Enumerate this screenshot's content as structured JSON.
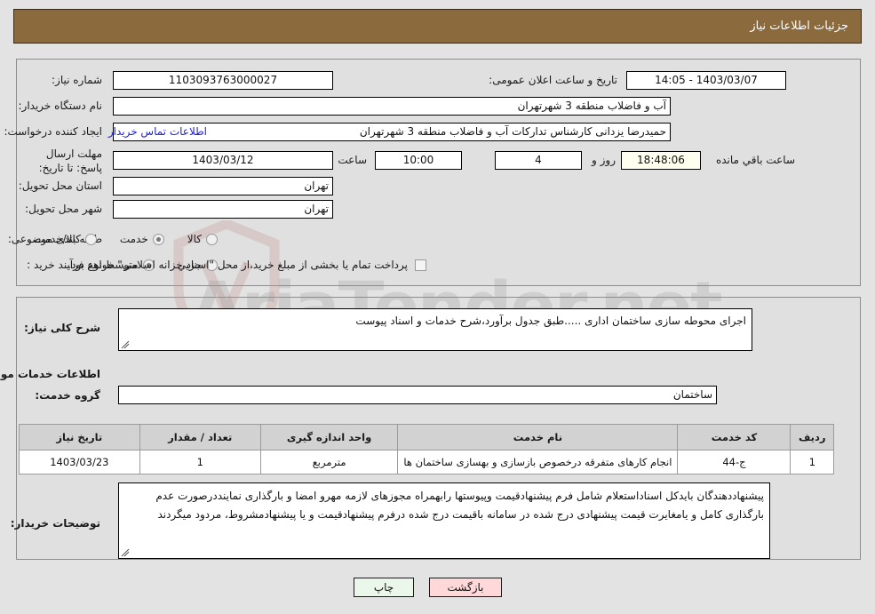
{
  "header": {
    "title": "جزئیات اطلاعات نیاز"
  },
  "top_panel": {
    "need_number_label": "شماره نیاز:",
    "need_number_value": "1103093763000027",
    "announce_datetime_label": "تاریخ و ساعت اعلان عمومی:",
    "announce_datetime_value": "1403/03/07 - 14:05",
    "buyer_org_label": "نام دستگاه خریدار:",
    "buyer_org_value": "آب و فاضلاب منطقه 3 شهرتهران",
    "requester_label": "ایجاد کننده درخواست:",
    "requester_value": "حمیدرضا یزدانی کارشناس تدارکات آب و فاضلاب منطقه 3 شهرتهران",
    "buyer_contact_link": "اطلاعات تماس خریدار",
    "deadline_label": "مهلت ارسال پاسخ: تا تاریخ:",
    "deadline_date_value": "1403/03/12",
    "deadline_time_label": "ساعت",
    "deadline_time_value": "10:00",
    "days_remaining_value": "4",
    "days_label": "روز و",
    "time_remaining_value": "18:48:06",
    "time_remaining_label": "ساعت باقي مانده",
    "province_label": "استان محل تحویل:",
    "province_value": "تهران",
    "city_label": "شهر محل تحویل:",
    "city_value": "تهران",
    "category_label": "طبقه بندی موضوعی:",
    "category_options": [
      {
        "label": "کالا",
        "selected": false
      },
      {
        "label": "خدمت",
        "selected": true
      },
      {
        "label": "کالا/خدمت",
        "selected": false
      }
    ],
    "process_label": "نوع فرآیند خرید :",
    "process_options": [
      {
        "label": "جزیي",
        "selected": false
      },
      {
        "label": "متوسط",
        "selected": true
      }
    ],
    "treasury_checkbox_checked": false,
    "treasury_text": "پرداخت تمام یا بخشی از مبلغ خرید،از محل \"اسناد خزانه اسلامی\" خواهد بود."
  },
  "mid_panel": {
    "general_desc_label": "شرح کلی نیاز:",
    "general_desc_value": "اجرای محوطه سازی ساختمان اداری .....طبق جدول برآورد،شرح خدمات و اسناد پیوست",
    "services_section_title": "اطلاعات خدمات مورد نیاز",
    "service_group_label": "گروه خدمت:",
    "service_group_value": "ساختمان",
    "table": {
      "columns": [
        "ردیف",
        "کد خدمت",
        "نام خدمت",
        "واحد اندازه گیری",
        "تعداد / مقدار",
        "تاریخ نیاز"
      ],
      "rows": [
        {
          "row_no": "1",
          "service_code": "ج-44",
          "service_name": "انجام کارهای متفرقه درخصوص بازسازی و بهسازی ساختمان ها",
          "unit": "مترمربع",
          "quantity": "1",
          "need_date": "1403/03/23"
        }
      ]
    },
    "buyer_notes_label": "توضیحات خریدار:",
    "buyer_notes_value": "پیشنهاددهندگان بایدکل اسناداستعلام شامل فرم پیشنهادقیمت وپیوستها رابهمراه مجوزهای لازمه مهرو امضا و بارگذاری نماینددرصورت عدم بارگذاری کامل و یامغایرت قیمت پیشنهادی درج شده در سامانه باقیمت درج شده درفرم پیشنهادقیمت و یا پیشنهادمشروط، مردود میگردند"
  },
  "footer": {
    "print_label": "چاپ",
    "back_label": "بازگشت"
  },
  "watermark": {
    "brand": "AriaTender.net"
  },
  "colors": {
    "header_bar": "#8b6b3e",
    "page_bg": "#e3e3e3",
    "panel_bg": "#e0e0e0",
    "link": "#2020d8",
    "table_header": "#d2d2d2",
    "print_button": "#eaf7ea",
    "back_button": "#ffd9d9",
    "timer_field": "#fffff0"
  }
}
